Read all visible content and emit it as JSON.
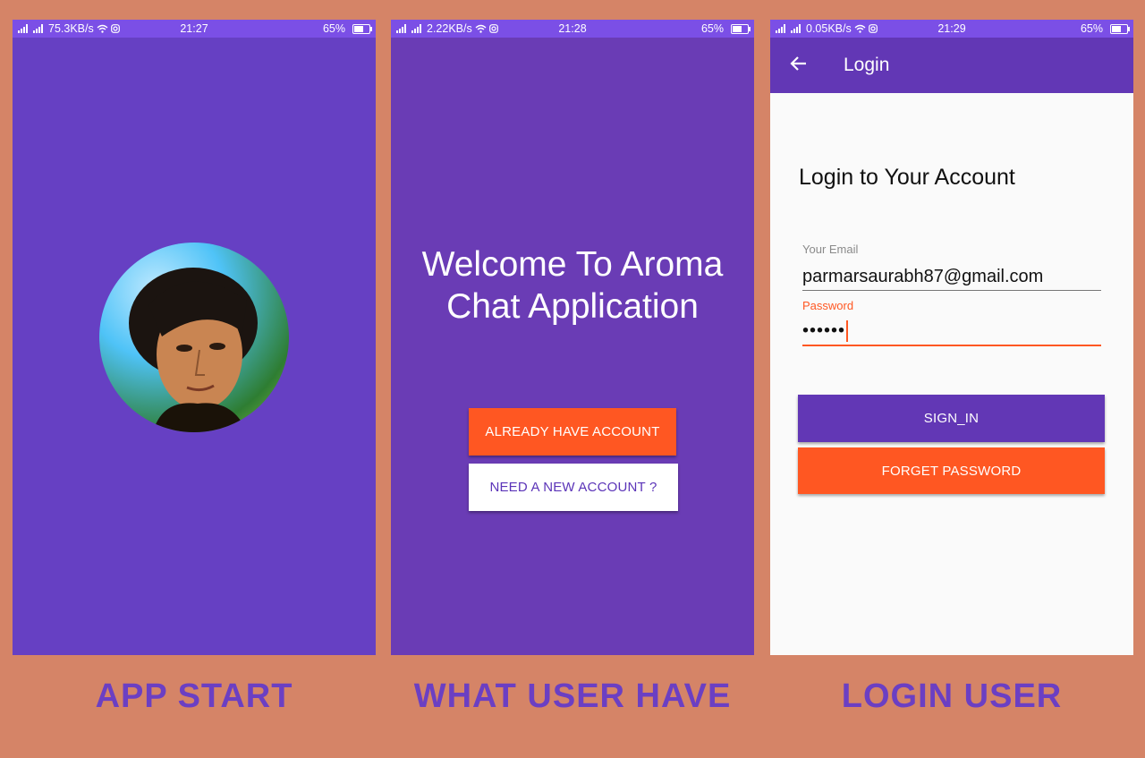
{
  "screens": [
    {
      "status": {
        "speed": "75.3KB/s",
        "time": "21:27",
        "battery": "65%"
      },
      "caption": "APP START"
    },
    {
      "status": {
        "speed": "2.22KB/s",
        "time": "21:28",
        "battery": "65%"
      },
      "welcome_line1": "Welcome To Aroma",
      "welcome_line2": "Chat Application",
      "already_label": "ALREADY HAVE ACCOUNT",
      "new_label": "NEED A NEW ACCOUNT ?",
      "caption": "WHAT USER HAVE"
    },
    {
      "status": {
        "speed": "0.05KB/s",
        "time": "21:29",
        "battery": "65%"
      },
      "appbar_title": "Login",
      "heading": "Login to Your Account",
      "email_label": "Your Email",
      "email_value": "parmarsaurabh87@gmail.com",
      "password_label": "Password",
      "password_value": "••••••",
      "signin_label": "SIGN_IN",
      "forget_label": "FORGET PASSWORD",
      "caption": "LOGIN USER"
    }
  ],
  "icons": [
    "signal-icon",
    "wifi-icon",
    "instagram-icon",
    "battery-icon",
    "back-arrow-icon"
  ],
  "colors": {
    "background": "#d58467",
    "primary": "#6237b5",
    "accent": "#ff5722",
    "status_bar": "#7b4fe6",
    "caption": "#6b3fc3"
  }
}
